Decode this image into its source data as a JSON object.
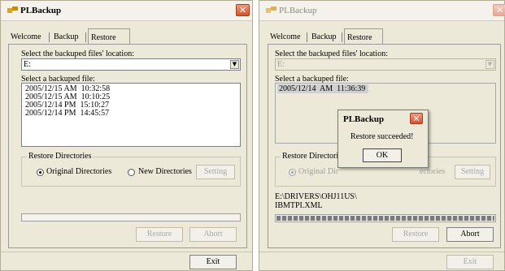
{
  "colors": {
    "window_bg": "#ece9d8",
    "close_red": "#d4532f",
    "selection_gray": "#d0d0d0"
  },
  "left": {
    "title": "PLBackup",
    "tabs": [
      {
        "label": "Welcome"
      },
      {
        "label": "Backup"
      },
      {
        "label": "Restore"
      }
    ],
    "location_label": "Select the backuped files' location:",
    "location_value": "E:",
    "file_label": "Select a backuped file:",
    "files": [
      "2005/12/15 AM  10:32:58",
      "2005/12/15 AM  10:10:25",
      "2005/12/14 PM  15:10:27",
      "2005/12/14 PM  14:45:57"
    ],
    "group_title": "Restore Directories",
    "radio_original": "Original Directories",
    "radio_new": "New Directories",
    "setting_button": "Setting",
    "restore_button": "Restore",
    "abort_button": "Abort",
    "exit_button": "Exit"
  },
  "right": {
    "title": "PLBackup",
    "tabs": [
      {
        "label": "Welcome"
      },
      {
        "label": "Backup"
      },
      {
        "label": "Restore"
      }
    ],
    "location_label": "Select the backuped files' location:",
    "location_value": "E:",
    "file_label": "Select a backuped file:",
    "files": [
      "2005/12/14  AM  11:36:39"
    ],
    "group_title": "Restore Directorie",
    "radio_original": "Original Dir",
    "radio_new": "ectories",
    "setting_button": "Setting",
    "path_line1": "E:\\DRIVERS\\OHJ11US\\",
    "path_line2": "IBMTPI.XML",
    "restore_button": "Restore",
    "abort_button": "Abort",
    "exit_button": "Exit",
    "dialog": {
      "title": "PLBackup",
      "message": "Restore succeeded!",
      "ok_button": "OK"
    }
  }
}
